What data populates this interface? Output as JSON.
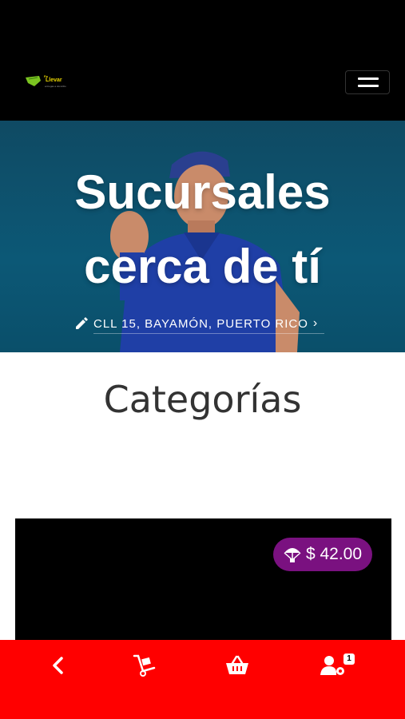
{
  "header": {
    "logo": {
      "small_text": "Pa",
      "name": "Llevar",
      "tagline": "entregas a domicilio"
    },
    "menu_icon": "hamburger-icon"
  },
  "hero": {
    "title_line1": "Sucursales",
    "title_line2": "cerca de tí",
    "address": "CLL 15, BAYAMÓN, PUERTO RICO",
    "address_icon": "pencil-icon",
    "address_arrow": "›"
  },
  "categories": {
    "title": "Categorías"
  },
  "card": {
    "price": "$ 42.00",
    "price_icon": "parachute-icon"
  },
  "bottom_nav": {
    "items": [
      {
        "icon": "back-arrow-icon"
      },
      {
        "icon": "hand-truck-icon"
      },
      {
        "icon": "basket-icon"
      },
      {
        "icon": "user-settings-icon",
        "badge": "1"
      }
    ]
  },
  "colors": {
    "header_bg": "#000000",
    "hero_bg": "#0c5876",
    "price_badge": "#7a1180",
    "bottom_nav_bg": "#ff0000",
    "text_dark": "#333333"
  }
}
